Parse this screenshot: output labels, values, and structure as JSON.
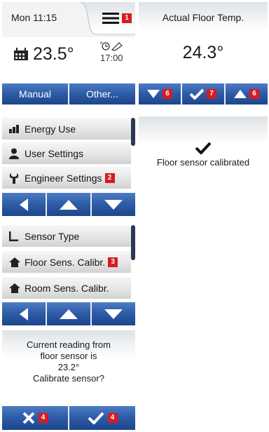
{
  "home": {
    "clock": "Mon 11:15",
    "temperature": "23.5°",
    "schedule_time": "17:00",
    "manual_label": "Manual",
    "other_label": "Other...",
    "menu_badge": "1"
  },
  "floor_temp": {
    "title": "Actual Floor Temp.",
    "value": "24.3°",
    "down_badge": "6",
    "ok_badge": "7",
    "up_badge": "6"
  },
  "main_menu": {
    "items": [
      {
        "label": "Energy Use",
        "icon": "bar-chart-icon"
      },
      {
        "label": "User Settings",
        "icon": "user-icon"
      },
      {
        "label": "Engineer Settings",
        "icon": "wrench-icon",
        "badge": "2"
      }
    ]
  },
  "calibrated": {
    "message": "Floor sensor calibrated"
  },
  "engineer_menu": {
    "items": [
      {
        "label": "Sensor Type",
        "icon": "sensor-type-icon"
      },
      {
        "label": "Floor Sens. Calibr.",
        "icon": "house-icon",
        "badge": "3"
      },
      {
        "label": "Room Sens. Calibr.",
        "icon": "house-icon"
      }
    ]
  },
  "confirm": {
    "line1": "Current reading from",
    "line2": "floor sensor is",
    "reading": "23.2°",
    "question": "Calibrate sensor?",
    "cancel_badge": "4",
    "ok_badge": "4"
  },
  "colors": {
    "button_blue": "#2f5da8",
    "badge_red": "#d51c22"
  }
}
